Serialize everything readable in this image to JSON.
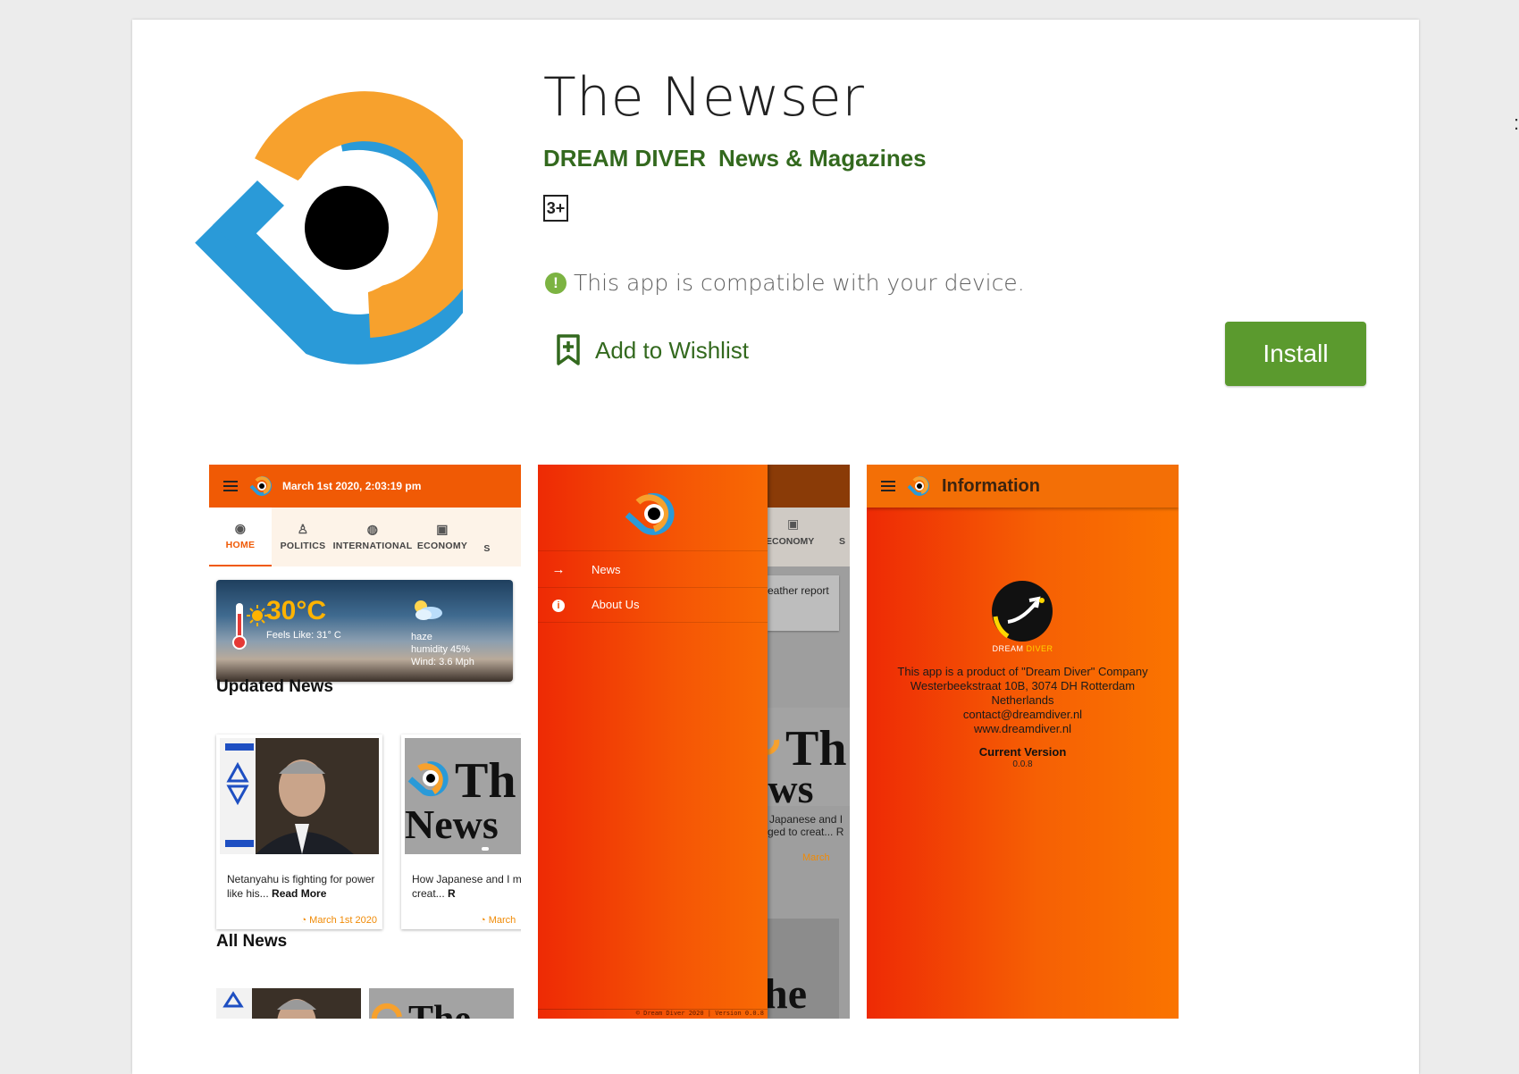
{
  "app": {
    "title": "The Newser",
    "developer": "DREAM DIVER",
    "category": "News & Magazines",
    "rating": "3+",
    "compatibility": "This app is compatible with your device.",
    "wishlist_label": "Add to Wishlist",
    "install_label": "Install"
  },
  "colors": {
    "accent_green": "#33691e",
    "install_green": "#5b9a2e",
    "brand_orange": "#f05a05"
  },
  "screens": {
    "home": {
      "datetime": "March 1st 2020, 2:03:19 pm",
      "tabs": [
        {
          "label": "HOME",
          "icon": "home-icon"
        },
        {
          "label": "POLITICS",
          "icon": "politics-icon"
        },
        {
          "label": "INTERNATIONAL",
          "icon": "globe-icon"
        },
        {
          "label": "ECONOMY",
          "icon": "economy-icon"
        },
        {
          "label": "S",
          "icon": ""
        }
      ],
      "weather": {
        "temperature": "30°C",
        "feels_like": "Feels Like: 31° C",
        "condition": "haze",
        "humidity": "humidity 45%",
        "wind": "Wind: 3.6 Mph"
      },
      "updated_news_title": "Updated News",
      "news": [
        {
          "headline": "Netanyahu is fighting for power like his...",
          "read_more": "Read More",
          "date": "March 1st 2020"
        },
        {
          "headline": "How Japanese and I merged to creat...",
          "read_more": "R",
          "date": "March"
        }
      ],
      "all_news_title": "All News"
    },
    "drawer": {
      "items": [
        {
          "label": "News",
          "icon": "arrow-right-icon"
        },
        {
          "label": "About Us",
          "icon": "info-icon"
        }
      ],
      "footer": "© Dream Diver 2020 | Version 0.0.8",
      "bg_tab": "ECONOMY",
      "bg_tab_cut": "S",
      "bg_weather": "eather report",
      "bg_news_1": "Japanese and I",
      "bg_news_2": "ged to creat... R",
      "bg_date": "March"
    },
    "info": {
      "title": "Information",
      "company_logo_text": "DREAM",
      "company_logo_text_2": "DIVER",
      "lines": [
        "This app is a product of \"Dream Diver\" Company",
        "Westerbeekstraat 10B, 3074 DH Rotterdam",
        "Netherlands",
        "contact@dreamdiver.nl",
        "www.dreamdiver.nl"
      ],
      "version_label": "Current Version",
      "version": "0.0.8"
    }
  }
}
